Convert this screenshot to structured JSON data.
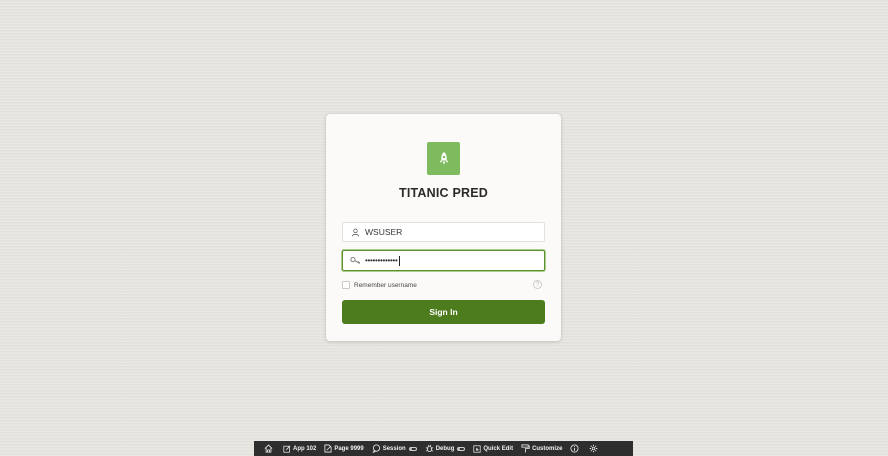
{
  "app": {
    "title": "TITANIC PRED",
    "logo_icon": "rocket-icon",
    "logo_color": "#7dbb5e"
  },
  "login": {
    "username_icon": "user-icon",
    "username_value": "WSUSER",
    "password_icon": "key-icon",
    "password_value": "•••••••••••••",
    "remember_label": "Remember username",
    "remember_checked": false,
    "help_icon": "help-icon",
    "signin_label": "Sign In",
    "signin_color": "#4d7c1e"
  },
  "dev_toolbar": {
    "home_icon": "home-icon",
    "app_label": "App 102",
    "page_label": "Page 9999",
    "session_label": "Session",
    "debug_label": "Debug",
    "quick_edit_label": "Quick Edit",
    "customize_label": "Customize",
    "info_icon": "info-icon",
    "settings_icon": "gear-icon"
  }
}
